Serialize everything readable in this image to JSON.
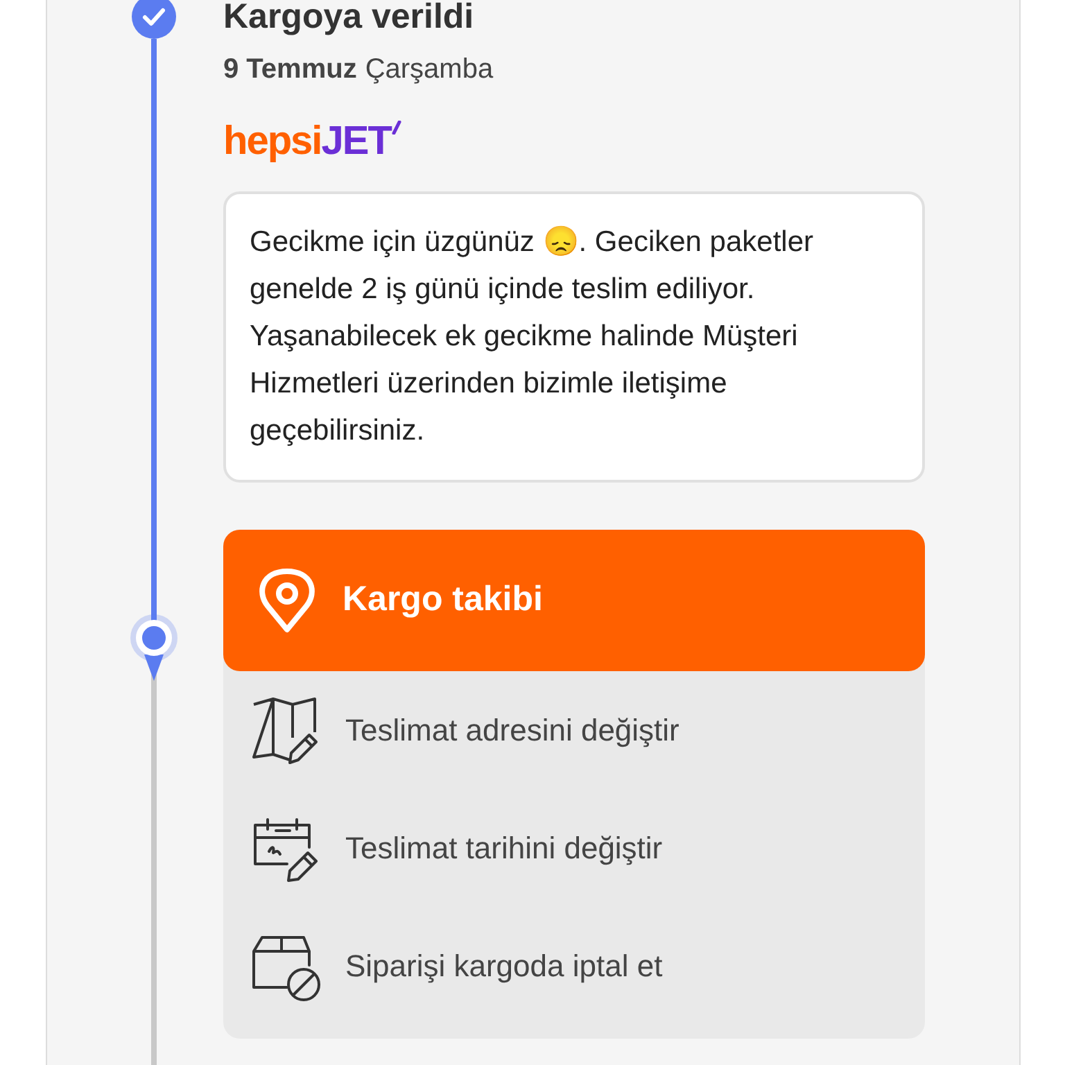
{
  "status": {
    "completed": true,
    "title": "Kargoya verildi",
    "date": "9 Temmuz",
    "weekday": "Çarşamba"
  },
  "carrier_logo": {
    "first": "hepsi",
    "second": "JET"
  },
  "message": "Gecikme için üzgünüz 😞. Geciken paketler genelde 2 iş günü içinde teslim ediliyor. Yaşanabilecek ek gecikme halinde Müşteri Hizmetleri üzerinden bizimle iletişime geçebilirsiniz.",
  "current_marker": true,
  "actions": [
    {
      "kind": "primary",
      "label": "Kargo takibi"
    },
    {
      "kind": "option",
      "label": "Teslimat adresini değiştir"
    },
    {
      "kind": "option",
      "label": "Teslimat tarihini değiştir"
    },
    {
      "kind": "option",
      "label": "Siparişi kargoda iptal et"
    }
  ]
}
